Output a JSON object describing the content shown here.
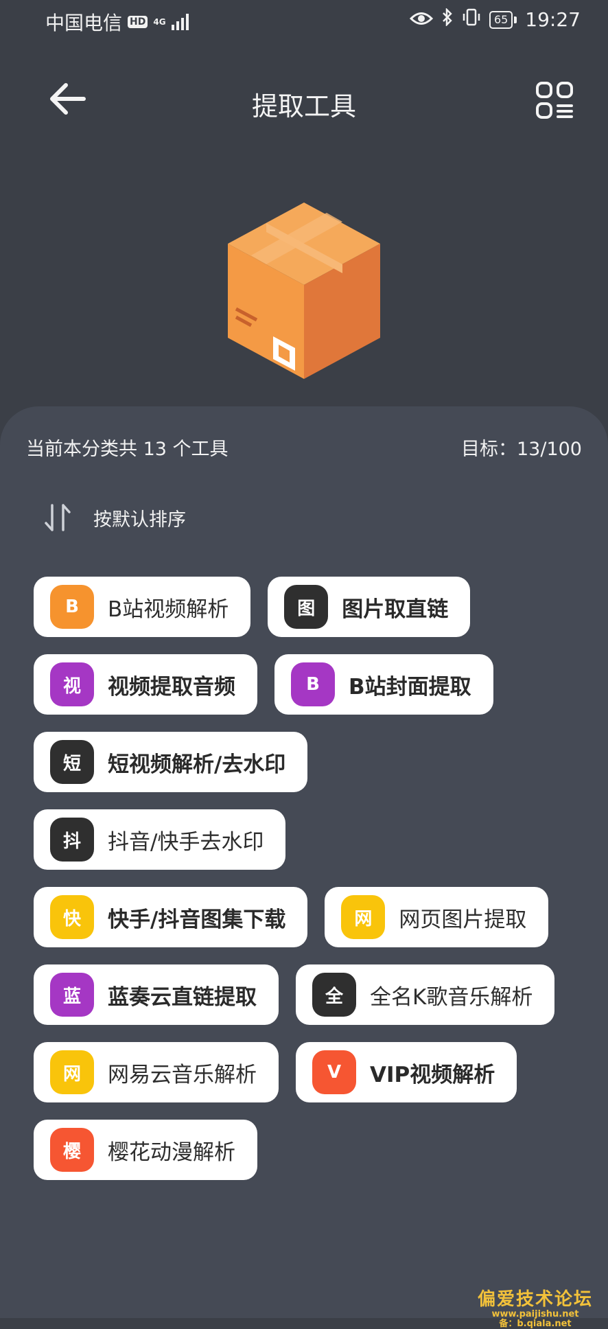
{
  "status_bar": {
    "carrier": "中国电信",
    "hd": "HD",
    "network": "4G",
    "battery": "65",
    "time": "19:27"
  },
  "header": {
    "title": "提取工具"
  },
  "summary": {
    "count_text": "当前本分类共 13 个工具",
    "target_text": "目标：13/100"
  },
  "sort": {
    "label": "按默认排序"
  },
  "tools": [
    {
      "icon_text": "B",
      "label": "B站视频解析",
      "color": "#f6932e",
      "bold": false
    },
    {
      "icon_text": "图",
      "label": "图片取直链",
      "color": "#2f2f2f",
      "bold": true
    },
    {
      "icon_text": "视",
      "label": "视频提取音频",
      "color": "#a537c4",
      "bold": true
    },
    {
      "icon_text": "B",
      "label": "B站封面提取",
      "color": "#a537c4",
      "bold": true
    },
    {
      "icon_text": "短",
      "label": "短视频解析/去水印",
      "color": "#2f2f2f",
      "bold": true
    },
    {
      "icon_text": "抖",
      "label": "抖音/快手去水印",
      "color": "#2f2f2f",
      "bold": false
    },
    {
      "icon_text": "快",
      "label": "快手/抖音图集下载",
      "color": "#f9c40b",
      "bold": true
    },
    {
      "icon_text": "网",
      "label": "网页图片提取",
      "color": "#f9c40b",
      "bold": false
    },
    {
      "icon_text": "蓝",
      "label": "蓝奏云直链提取",
      "color": "#a537c4",
      "bold": true
    },
    {
      "icon_text": "全",
      "label": "全名K歌音乐解析",
      "color": "#2f2f2f",
      "bold": false
    },
    {
      "icon_text": "网",
      "label": "网易云音乐解析",
      "color": "#f9c40b",
      "bold": false
    },
    {
      "icon_text": "V",
      "label": "VIP视频解析",
      "color": "#f65632",
      "bold": true
    },
    {
      "icon_text": "樱",
      "label": "樱花动漫解析",
      "color": "#f65632",
      "bold": false
    }
  ],
  "watermark": {
    "title": "偏爱技术论坛",
    "url": "www.paijishu.net",
    "sub": "备：b.qiala.net"
  }
}
